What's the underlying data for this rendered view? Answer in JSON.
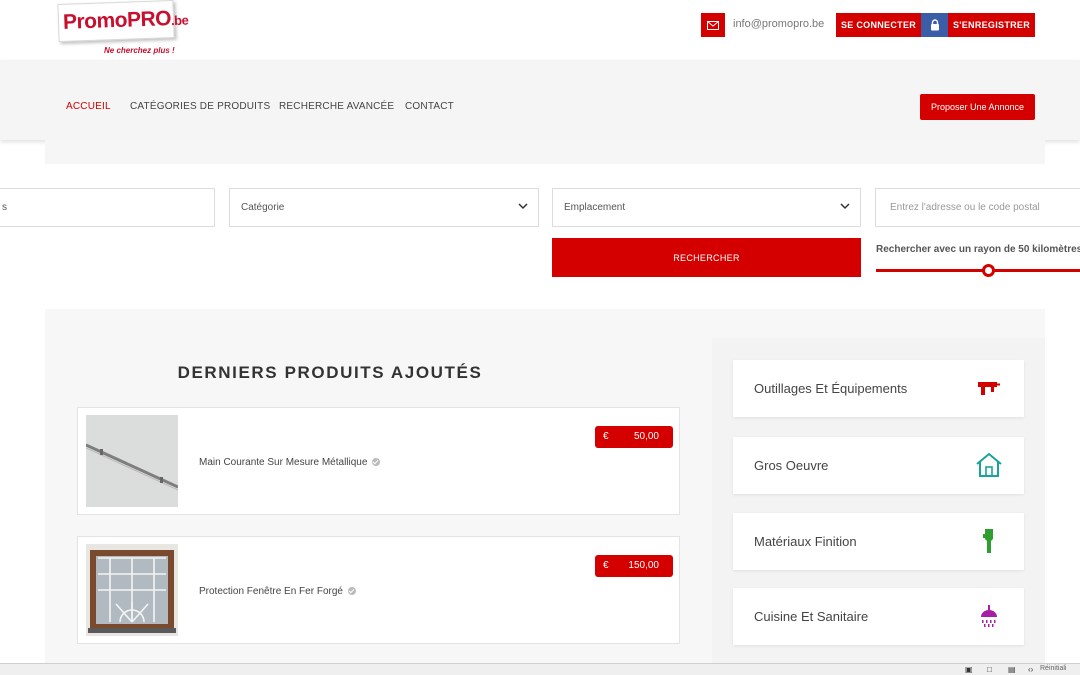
{
  "header": {
    "logo_main": "PromoPRO",
    "logo_suffix": ".be",
    "logo_tagline": "Ne cherchez plus !",
    "email": "info@promopro.be",
    "login_label": "SE CONNECTER",
    "register_label": "S'ENREGISTRER"
  },
  "nav": {
    "items": [
      {
        "label": "ACCUEIL"
      },
      {
        "label": "CATÉGORIES DE PRODUITS"
      },
      {
        "label": "RECHERCHE AVANCÉE"
      },
      {
        "label": "CONTACT"
      }
    ],
    "propose_label": "Proposer Une Annonce"
  },
  "search": {
    "keyword_partial": "s",
    "category_label": "Catégorie",
    "location_label": "Emplacement",
    "address_placeholder": "Entrez l'adresse ou le code postal",
    "submit_label": "RECHERCHER",
    "radius_label": "Rechercher avec un rayon de 50 kilomètres",
    "radius_fraction": 0.5
  },
  "products": {
    "title": "DERNIERS PRODUITS AJOUTÉS",
    "items": [
      {
        "name": "Main Courante Sur Mesure Métallique",
        "currency": "€",
        "price": "50,00"
      },
      {
        "name": "Protection Fenêtre En Fer Forgé",
        "currency": "€",
        "price": "150,00"
      }
    ]
  },
  "categories": [
    {
      "label": "Outillages Et Équipements",
      "icon": "drill-icon",
      "color": "#d40000"
    },
    {
      "label": "Gros Oeuvre",
      "icon": "house-icon",
      "color": "#1aa39a"
    },
    {
      "label": "Matériaux Finition",
      "icon": "brush-icon",
      "color": "#2e9e2e"
    },
    {
      "label": "Cuisine Et Sanitaire",
      "icon": "shower-icon",
      "color": "#a61fa6"
    }
  ],
  "statusbar": {
    "reset_label": "Réinitiali"
  },
  "colors": {
    "accent": "#d40000",
    "lock_blue": "#3b5da8"
  }
}
